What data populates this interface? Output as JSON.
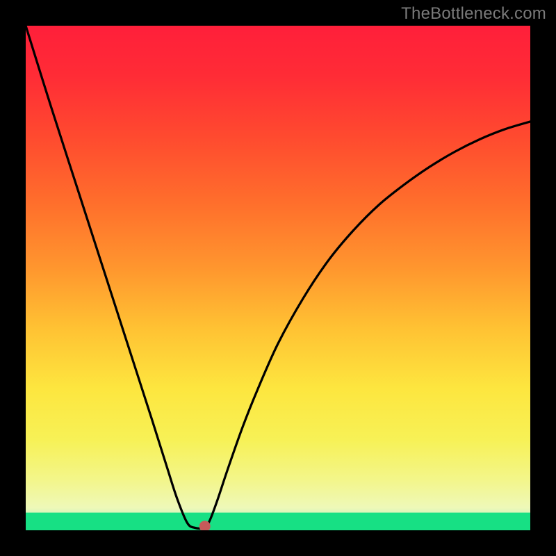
{
  "watermark": "TheBottleneck.com",
  "chart_data": {
    "type": "line",
    "title": "",
    "xlabel": "",
    "ylabel": "",
    "xlim": [
      0,
      100
    ],
    "ylim": [
      0,
      100
    ],
    "series": [
      {
        "name": "curve",
        "x": [
          0,
          5,
          10,
          15,
          20,
          25,
          28,
          30,
          32,
          33.5,
          35.5,
          36.5,
          38,
          40,
          43,
          46,
          50,
          55,
          60,
          65,
          70,
          75,
          80,
          85,
          90,
          95,
          100
        ],
        "y": [
          100,
          84,
          68.5,
          53,
          37.5,
          22,
          12.5,
          6.3,
          1.5,
          0.5,
          0.5,
          2,
          6,
          12,
          20.5,
          28,
          37,
          46,
          53.5,
          59.5,
          64.5,
          68.5,
          72,
          75,
          77.5,
          79.5,
          81
        ]
      }
    ],
    "marker": {
      "x": 35.5,
      "y": 0.8,
      "color": "#c65a5a",
      "r": 1.1
    },
    "green_band": {
      "y_start": 0,
      "y_end": 3.5
    },
    "gradient_stops": [
      {
        "offset": 0.0,
        "color": "#ff1f3a"
      },
      {
        "offset": 0.1,
        "color": "#ff2c36"
      },
      {
        "offset": 0.22,
        "color": "#ff4a2f"
      },
      {
        "offset": 0.35,
        "color": "#ff6e2c"
      },
      {
        "offset": 0.48,
        "color": "#ff962e"
      },
      {
        "offset": 0.6,
        "color": "#ffc233"
      },
      {
        "offset": 0.72,
        "color": "#fde63f"
      },
      {
        "offset": 0.82,
        "color": "#f7f156"
      },
      {
        "offset": 0.9,
        "color": "#f3f68a"
      },
      {
        "offset": 0.955,
        "color": "#eef8b8"
      },
      {
        "offset": 0.975,
        "color": "#c7f3bc"
      },
      {
        "offset": 0.99,
        "color": "#6de9a3"
      },
      {
        "offset": 1.0,
        "color": "#17e084"
      }
    ]
  }
}
